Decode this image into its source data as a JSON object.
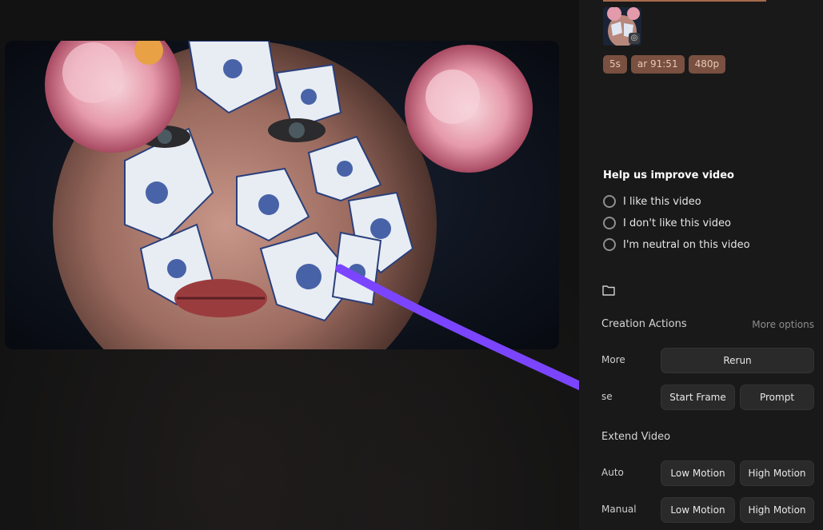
{
  "video": {
    "alt": "Portrait of a woman with porcelain shard mosaic and pink peonies"
  },
  "thumbnail": {
    "badge_icon": "settings-icon"
  },
  "tags": [
    "5s",
    "ar 91:51",
    "480p"
  ],
  "feedback": {
    "title": "Help us improve video",
    "options": [
      "I like this video",
      "I don't like this video",
      "I'm neutral on this video"
    ]
  },
  "folder": {
    "icon": "folder-icon"
  },
  "creation_actions": {
    "title": "Creation Actions",
    "more_options": "More options",
    "more_label": "More",
    "rerun": "Rerun",
    "use_label": "se",
    "start_frame": "Start Frame",
    "prompt": "Prompt"
  },
  "extend_video": {
    "title": "Extend Video",
    "auto_label": "Auto",
    "manual_label": "Manual",
    "low_motion": "Low Motion",
    "high_motion": "High Motion"
  },
  "colors": {
    "accent_tag": "#7a5040",
    "arrow": "#7b45ff",
    "panel": "#191919"
  }
}
